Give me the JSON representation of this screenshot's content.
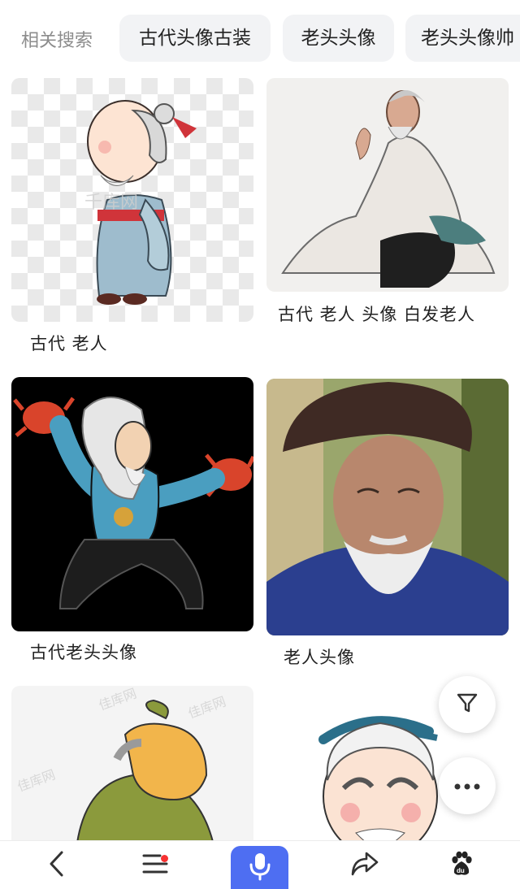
{
  "related": {
    "title": "相关搜索",
    "chips": [
      "古代头像古装",
      "老头头像",
      "老头头像帅"
    ]
  },
  "results": [
    {
      "caption": "古代 老人",
      "image": "cartoon-old-man-in-blue-robe",
      "watermark": "千库网"
    },
    {
      "caption": "古代 老人 头像 白发老人",
      "image": "ink-painting-old-sage"
    },
    {
      "caption": "古代老头头像",
      "image": "cartoon-old-man-holding-crabs"
    },
    {
      "caption": "老人头像",
      "image": "photo-old-man-with-fur-hat"
    },
    {
      "caption": "",
      "image": "cartoon-bald-old-man-green-robe",
      "watermark": "佳库网"
    },
    {
      "caption": "",
      "image": "cartoon-confucius-face"
    }
  ],
  "fabs": {
    "filter": "filter-icon",
    "more": "more-icon"
  },
  "bottom_nav": {
    "items": [
      "back-icon",
      "menu-icon",
      "microphone-icon",
      "share-icon",
      "baidu-paw-icon"
    ],
    "voice_color": "#4e6ef2",
    "badge_color": "#f73131"
  }
}
